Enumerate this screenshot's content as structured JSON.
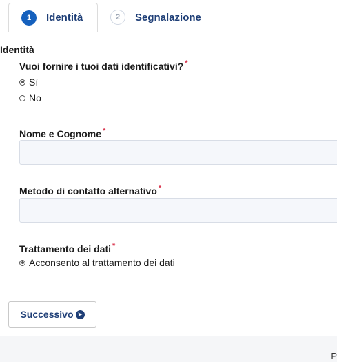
{
  "tabs": [
    {
      "number": "1",
      "label": "Identità"
    },
    {
      "number": "2",
      "label": "Segnalazione"
    }
  ],
  "section_title": "Identità",
  "question": {
    "label": "Vuoi fornire i tuoi dati identificativi?",
    "required_mark": "*",
    "options": [
      {
        "label": "Sì",
        "checked": true
      },
      {
        "label": "No",
        "checked": false
      }
    ]
  },
  "fields": {
    "name": {
      "label": "Nome e Cognome",
      "required_mark": "*",
      "value": ""
    },
    "contact": {
      "label": "Metodo di contatto alternativo",
      "required_mark": "*",
      "value": ""
    }
  },
  "consent": {
    "label": "Trattamento dei dati",
    "required_mark": "*",
    "option": {
      "label": "Acconsento al trattamento dei dati",
      "checked": true
    }
  },
  "next_button": {
    "label": "Successivo",
    "icon": "arrow-right-circle-icon"
  },
  "footer_text": "P",
  "colors": {
    "primary": "#1f3f77",
    "step_active": "#1560bd",
    "required": "#d9364f",
    "input_bg": "#f5f7fb"
  }
}
